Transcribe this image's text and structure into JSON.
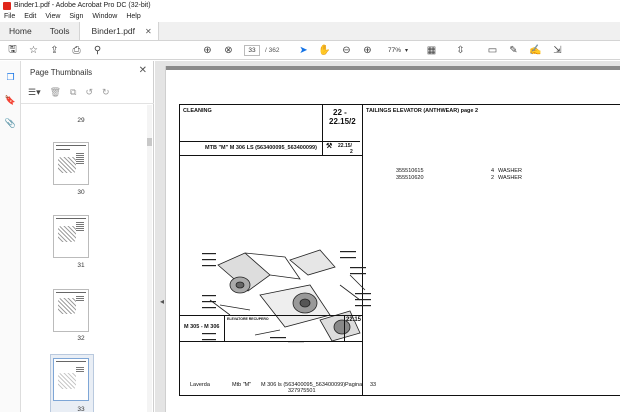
{
  "window": {
    "title": "Binder1.pdf - Adobe Acrobat Pro DC (32-bit)"
  },
  "menu": [
    "File",
    "Edit",
    "View",
    "Sign",
    "Window",
    "Help"
  ],
  "tabs": {
    "home": "Home",
    "tools": "Tools",
    "document": "Binder1.pdf"
  },
  "toolbar": {
    "page_current": "33",
    "page_total": "/ 362",
    "zoom": "77%",
    "icons": [
      "save-icon",
      "star-icon",
      "upload-icon",
      "print-icon",
      "search-icon",
      "prev-page-icon",
      "next-page-icon",
      "cursor-icon",
      "hand-icon",
      "zoom-out-icon",
      "zoom-in-icon",
      "page-view-icon",
      "scroll-icon",
      "comment-icon",
      "pen-icon",
      "sign-icon",
      "share-icon"
    ]
  },
  "panel": {
    "title": "Page Thumbnails",
    "thumbnails": [
      {
        "label": "29"
      },
      {
        "label": "30"
      },
      {
        "label": "31"
      },
      {
        "label": "32"
      },
      {
        "label": "33"
      }
    ]
  },
  "document": {
    "header_left": "CLEANING",
    "header_code_top": "22 -",
    "header_code_bottom": "22.15/2",
    "header_ref": "22.15/",
    "header_ref2": "2",
    "header_right": "TAILINGS ELEVATOR (ANTHWEAR) page 2",
    "model_line": "MTB \"M\" M 306 LS (563400095_563400099)",
    "parts": [
      {
        "code": "355510615",
        "qty": "4",
        "name": "WASHER"
      },
      {
        "code": "355510620",
        "qty": "2",
        "name": "WASHER"
      }
    ],
    "caption_model": "M 305 - M 306",
    "caption_code": "22.15",
    "caption_title": "ELEVATORE RECUPERO",
    "footer": {
      "brand": "Laverda",
      "mtb": "Mtb \"M\"",
      "model": "M 306 ls (563400095_563400099)",
      "page_label": "Pagina",
      "page_num": "33",
      "part_no": "327975501"
    }
  }
}
